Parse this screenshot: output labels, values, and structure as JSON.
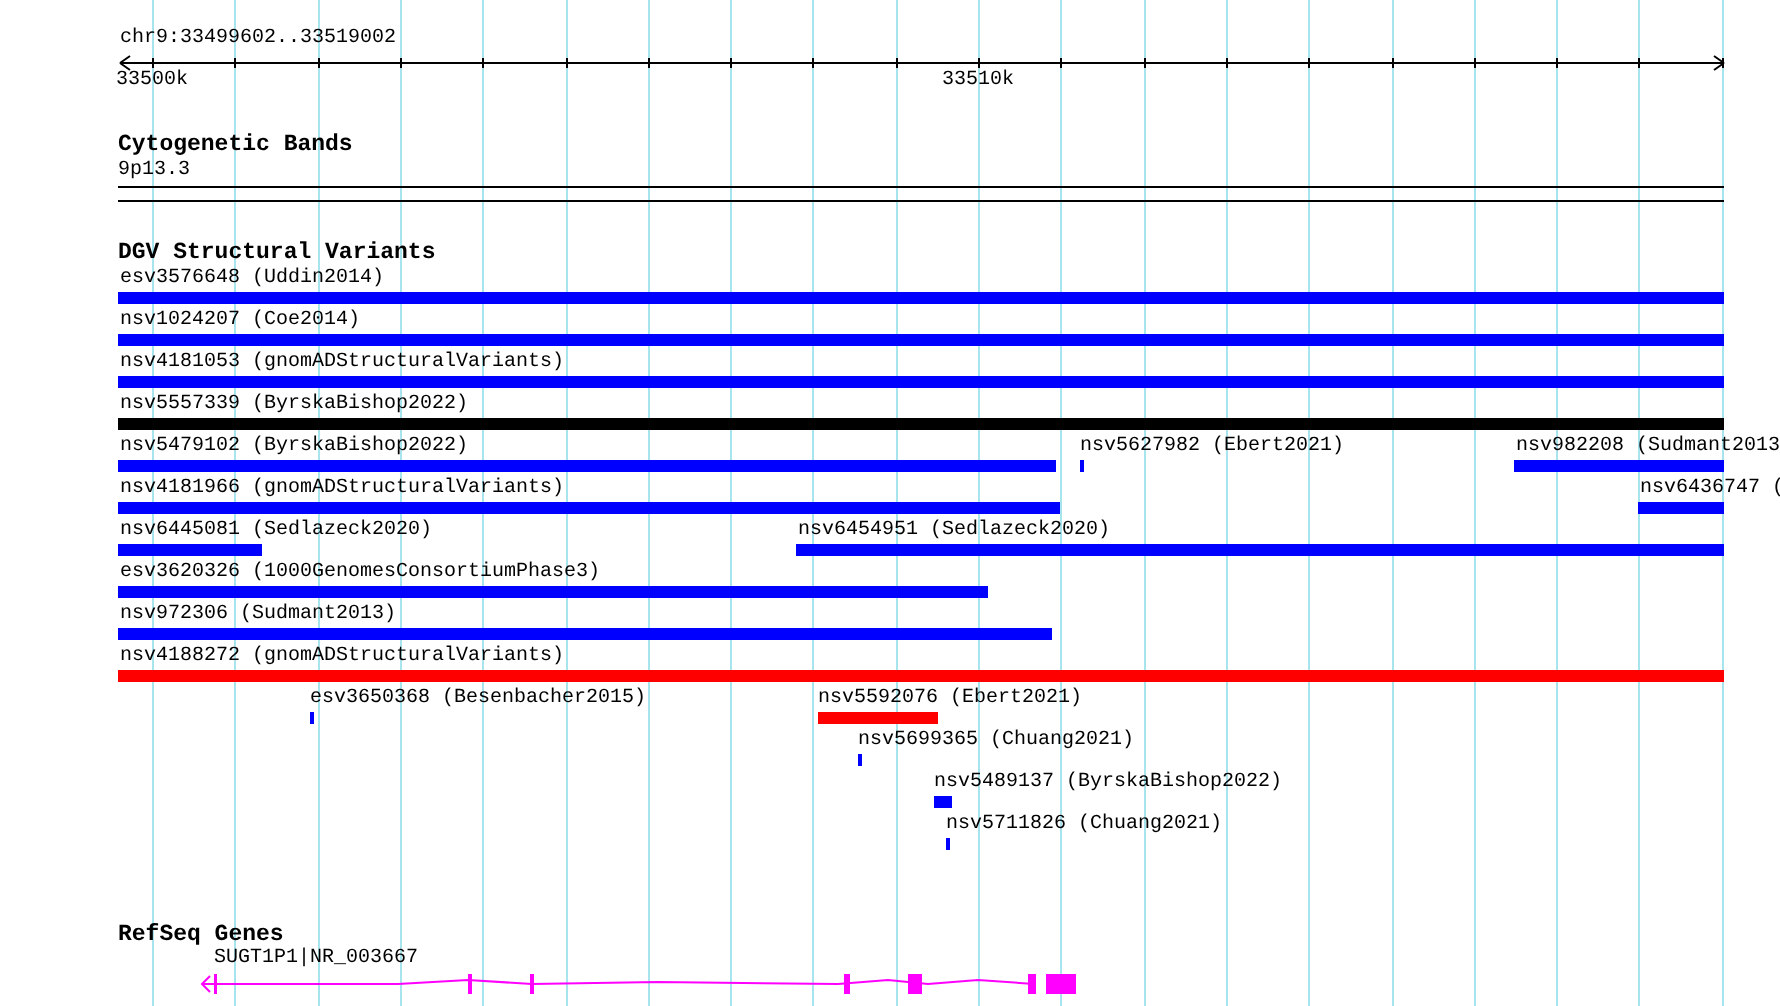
{
  "location": "chr9:33499602..33519002",
  "ruler": {
    "ticks": [
      "33500k",
      "33510k"
    ]
  },
  "cytogenetic_bands": {
    "title": "Cytogenetic Bands",
    "band": "9p13.3"
  },
  "dgv": {
    "title": "DGV Structural Variants",
    "rows": [
      {
        "features": [
          {
            "label": "esv3576648 (Uddin2014)",
            "color": "#0000ff"
          }
        ]
      },
      {
        "features": [
          {
            "label": "nsv1024207 (Coe2014)",
            "color": "#0000ff"
          }
        ]
      },
      {
        "features": [
          {
            "label": "nsv4181053 (gnomADStructuralVariants)",
            "color": "#0000ff"
          }
        ]
      },
      {
        "features": [
          {
            "label": "nsv5557339 (ByrskaBishop2022)",
            "color": "#000000"
          }
        ]
      },
      {
        "features": [
          {
            "label": "nsv5479102 (ByrskaBishop2022)",
            "color": "#0000ff"
          },
          {
            "label": "nsv5627982 (Ebert2021)",
            "color": "#0000ff"
          },
          {
            "label": "nsv982208 (Sudmant2013",
            "color": "#0000ff"
          }
        ]
      },
      {
        "features": [
          {
            "label": "nsv4181966 (gnomADStructuralVariants)",
            "color": "#0000ff"
          },
          {
            "label": "nsv6436747 (",
            "color": "#0000ff"
          }
        ]
      },
      {
        "features": [
          {
            "label": "nsv6445081 (Sedlazeck2020)",
            "color": "#0000ff"
          },
          {
            "label": "nsv6454951 (Sedlazeck2020)",
            "color": "#0000ff"
          }
        ]
      },
      {
        "features": [
          {
            "label": "esv3620326 (1000GenomesConsortiumPhase3)",
            "color": "#0000ff"
          }
        ]
      },
      {
        "features": [
          {
            "label": "nsv972306 (Sudmant2013)",
            "color": "#0000ff"
          }
        ]
      },
      {
        "features": [
          {
            "label": "nsv4188272 (gnomADStructuralVariants)",
            "color": "#ff0000"
          }
        ]
      },
      {
        "features": [
          {
            "label": "esv3650368 (Besenbacher2015)",
            "color": "#0000ff"
          },
          {
            "label": "nsv5592076 (Ebert2021)",
            "color": "#ff0000"
          }
        ]
      },
      {
        "features": [
          {
            "label": "nsv5699365 (Chuang2021)",
            "color": "#0000ff"
          }
        ]
      },
      {
        "features": [
          {
            "label": "nsv5489137 (ByrskaBishop2022)",
            "color": "#0000ff"
          }
        ]
      },
      {
        "features": [
          {
            "label": "nsv5711826 (Chuang2021)",
            "color": "#0000ff"
          }
        ]
      }
    ]
  },
  "refseq": {
    "title": "RefSeq Genes",
    "genes": [
      {
        "label": "SUGT1P1|NR_003667"
      }
    ]
  }
}
